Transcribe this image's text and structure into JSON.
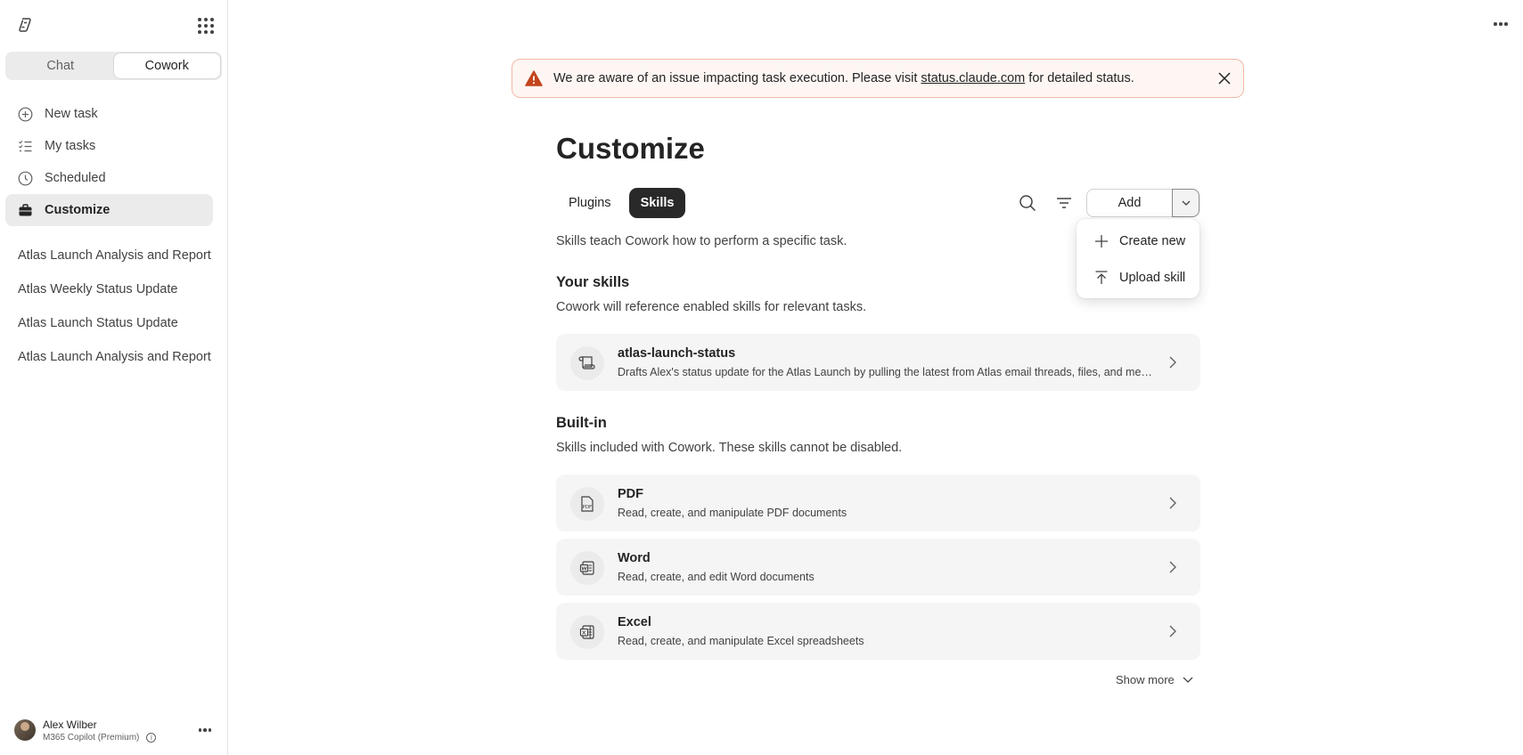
{
  "sidebar": {
    "mode_tabs": [
      "Chat",
      "Cowork"
    ],
    "nav": [
      {
        "label": "New task",
        "icon": "plus-circle-icon"
      },
      {
        "label": "My tasks",
        "icon": "task-list-icon"
      },
      {
        "label": "Scheduled",
        "icon": "clock-icon"
      },
      {
        "label": "Customize",
        "icon": "briefcase-icon"
      }
    ],
    "recent": [
      "Atlas Launch Analysis and Report",
      "Atlas Weekly Status Update",
      "Atlas Launch Status Update",
      "Atlas Launch Analysis and Report"
    ],
    "user": {
      "name": "Alex Wilber",
      "plan": "M365 Copilot (Premium)"
    }
  },
  "banner": {
    "text_before": "We are aware of an issue impacting task execution. Please visit ",
    "link": "status.claude.com",
    "text_after": " for detailed status."
  },
  "main": {
    "title": "Customize",
    "tabs": [
      "Plugins",
      "Skills"
    ],
    "description": "Skills teach Cowork how to perform a specific task.",
    "add_label": "Add",
    "add_menu": [
      "Create new",
      "Upload skill"
    ],
    "your_skills": {
      "heading": "Your skills",
      "subtitle": "Cowork will reference enabled skills for relevant tasks.",
      "items": [
        {
          "name": "atlas-launch-status",
          "desc": "Drafts Alex's status update for the Atlas Launch by pulling the latest from Atlas email threads, files, and meetings"
        }
      ]
    },
    "built_in": {
      "heading": "Built-in",
      "subtitle": "Skills included with Cowork. These skills cannot be disabled.",
      "items": [
        {
          "name": "PDF",
          "desc": "Read, create, and manipulate PDF documents"
        },
        {
          "name": "Word",
          "desc": "Read, create, and edit Word documents"
        },
        {
          "name": "Excel",
          "desc": "Read, create, and manipulate Excel spreadsheets"
        }
      ]
    },
    "show_more": "Show more"
  },
  "colors": {
    "accent_dark": "#292929",
    "banner_border": "#f2b8a6",
    "warning": "#c4441c"
  }
}
